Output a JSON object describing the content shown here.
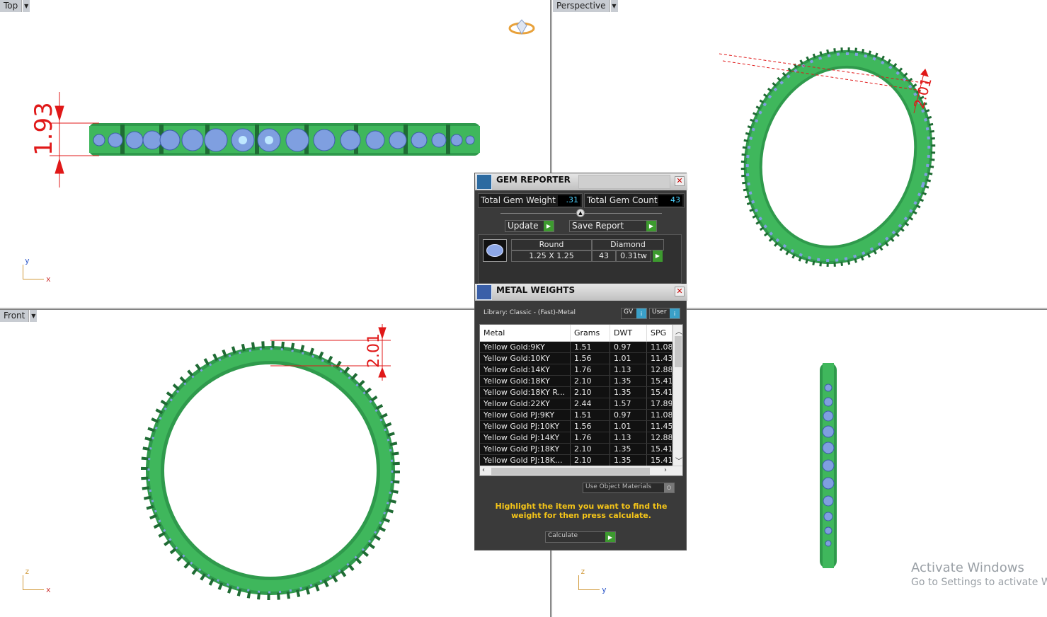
{
  "viewports": {
    "top": {
      "label": "Top",
      "dimension": "1.93",
      "axis_v": "y",
      "axis_h": "x"
    },
    "perspective": {
      "label": "Perspective",
      "dimension": "2.01"
    },
    "front": {
      "label": "Front",
      "dimension": "2.01",
      "axis_v": "z",
      "axis_h": "x"
    },
    "right": {
      "axis_v": "z",
      "axis_h": "y"
    }
  },
  "gem_reporter": {
    "title": "GEM REPORTER",
    "total_weight_label": "Total Gem Weight",
    "total_weight_value": ".31",
    "total_count_label": "Total Gem Count",
    "total_count_value": "43",
    "update_label": "Update",
    "save_report_label": "Save Report",
    "gem": {
      "shape_header": "Round",
      "material_header": "Diamond",
      "size": "1.25 X 1.25",
      "count": "43",
      "weight": "0.31tw"
    }
  },
  "metal_weights": {
    "title": "METAL WEIGHTS",
    "library": "Library: Classic - (Fast)-Metal",
    "gv_label": "GV",
    "user_label": "User",
    "columns": [
      "Metal",
      "Grams",
      "DWT",
      "SPG"
    ],
    "rows": [
      [
        "Yellow Gold:9KY",
        "1.51",
        "0.97",
        "11.08"
      ],
      [
        "Yellow Gold:10KY",
        "1.56",
        "1.01",
        "11.43"
      ],
      [
        "Yellow Gold:14KY",
        "1.76",
        "1.13",
        "12.88"
      ],
      [
        "Yellow Gold:18KY",
        "2.10",
        "1.35",
        "15.41"
      ],
      [
        "Yellow Gold:18KY R...",
        "2.10",
        "1.35",
        "15.41"
      ],
      [
        "Yellow Gold:22KY",
        "2.44",
        "1.57",
        "17.89"
      ],
      [
        "Yellow Gold PJ:9KY",
        "1.51",
        "0.97",
        "11.08"
      ],
      [
        "Yellow Gold PJ:10KY",
        "1.56",
        "1.01",
        "11.45"
      ],
      [
        "Yellow Gold PJ:14KY",
        "1.76",
        "1.13",
        "12.88"
      ],
      [
        "Yellow Gold PJ:18KY",
        "2.10",
        "1.35",
        "15.41"
      ],
      [
        "Yellow Gold PJ:18K...",
        "2.10",
        "1.35",
        "15.41"
      ]
    ],
    "use_object_materials": "Use Object Materials",
    "hint": "Highlight the item you want to find the weight for then press calculate.",
    "calculate_label": "Calculate"
  },
  "watermark": {
    "line1": "Activate Windows",
    "line2": "Go to Settings to activate Wi"
  },
  "colors": {
    "ring_green": "#3fae5a",
    "ring_dark": "#1f6b34",
    "gem_blue": "#7f9fe0",
    "dimension_red": "#e01818",
    "hint_yellow": "#f5c518",
    "accent_green_button": "#3d9a2f"
  }
}
